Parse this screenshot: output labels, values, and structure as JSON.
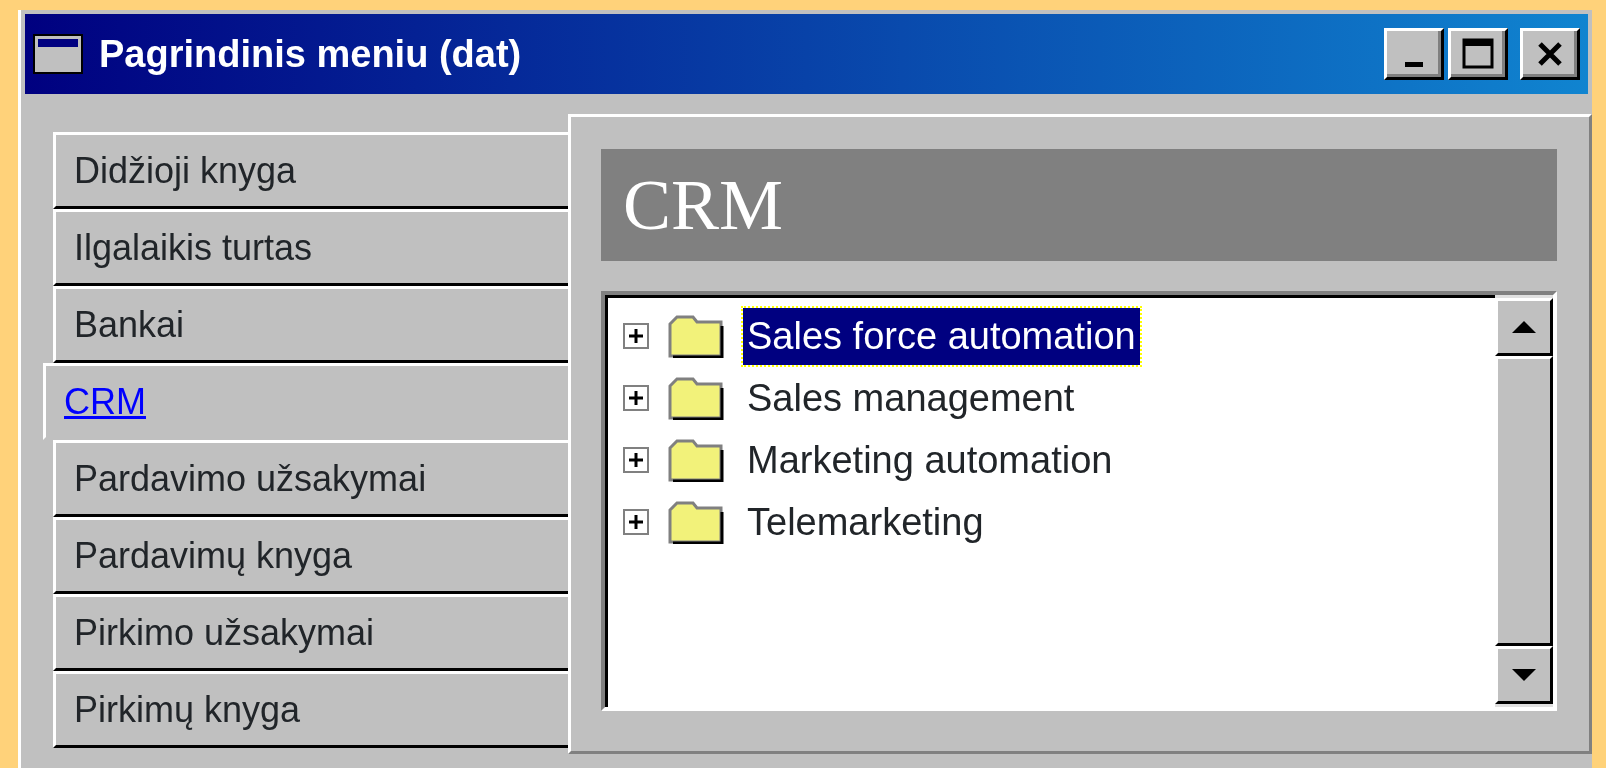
{
  "window": {
    "title": "Pagrindinis meniu (dat)"
  },
  "tabs": [
    {
      "label": "Didžioji knyga",
      "selected": false
    },
    {
      "label": "Ilgalaikis turtas",
      "selected": false
    },
    {
      "label": "Bankai",
      "selected": false
    },
    {
      "label": "CRM",
      "selected": true
    },
    {
      "label": "Pardavimo užsakymai",
      "selected": false
    },
    {
      "label": "Pardavimų knyga",
      "selected": false
    },
    {
      "label": "Pirkimo užsakymai",
      "selected": false
    },
    {
      "label": "Pirkimų knyga",
      "selected": false
    }
  ],
  "panel": {
    "heading": "CRM"
  },
  "tree": {
    "items": [
      {
        "label": "Sales force automation",
        "expanded": false,
        "selected": true
      },
      {
        "label": "Sales management",
        "expanded": false,
        "selected": false
      },
      {
        "label": "Marketing automation",
        "expanded": false,
        "selected": false
      },
      {
        "label": "Telemarketing",
        "expanded": false,
        "selected": false
      }
    ]
  }
}
